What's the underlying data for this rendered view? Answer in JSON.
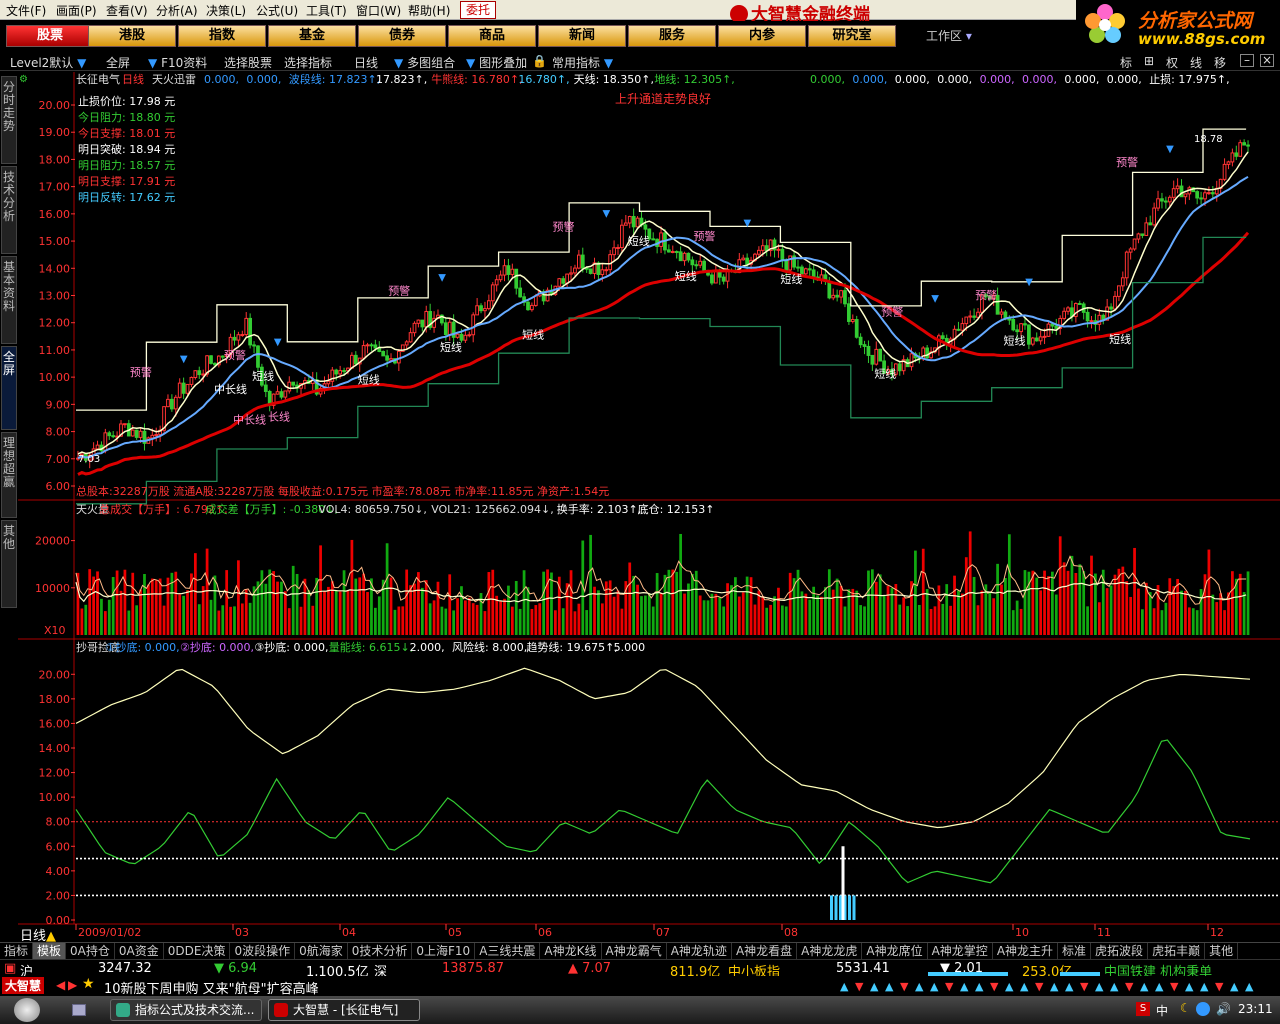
{
  "menu": [
    "文件(F)",
    "画面(P)",
    "查看(V)",
    "分析(A)",
    "决策(L)",
    "公式(U)",
    "工具(T)",
    "窗口(W)",
    "帮助(H)"
  ],
  "weituo": "委托",
  "brand": "大智慧金融终端",
  "site": {
    "name": "分析家公式网",
    "url": "www.88gs.com"
  },
  "nav": [
    "股票",
    "港股",
    "指数",
    "基金",
    "债券",
    "商品",
    "新闻",
    "服务",
    "内参",
    "研究室"
  ],
  "workspace": "工作区",
  "toolbar": {
    "level2": "Level2默认",
    "full": "全屏",
    "f10": "F10资料",
    "select": "选择股票",
    "pick": "选择指标",
    "period": "日线",
    "multi": "多图组合",
    "overlay": "图形叠加",
    "common": "常用指标",
    "right": [
      "标",
      "⊞",
      "权",
      "线",
      "移"
    ]
  },
  "sidetabs": [
    "分时走势",
    "技术分析",
    "基本资料",
    "全屏",
    "理想超赢",
    "其他"
  ],
  "price_panel": {
    "header_name": "长征电气",
    "header_period": "日线",
    "header_ind": "天火迅雷",
    "values": [
      {
        "t": "0.000,",
        "c": "#39f"
      },
      {
        "t": "0.000,",
        "c": "#39f"
      },
      {
        "t": "波段线: 17.823↑,",
        "c": "#39f"
      },
      {
        "t": "17.823↑,",
        "c": "#fff"
      },
      {
        "t": "牛熊线: 16.780↑,",
        "c": "#f33"
      },
      {
        "t": "16.780↑,",
        "c": "#4cf"
      },
      {
        "t": "天线: 18.350↑,",
        "c": "#fff"
      },
      {
        "t": "地线: 12.305↑,",
        "c": "#3c3"
      }
    ],
    "values2": [
      {
        "t": "0.000,",
        "c": "#3c3"
      },
      {
        "t": "0.000,",
        "c": "#39f"
      },
      {
        "t": "0.000,",
        "c": "#fff"
      },
      {
        "t": "0.000,",
        "c": "#fff"
      },
      {
        "t": "0.000,",
        "c": "#c6f"
      },
      {
        "t": "0.000,",
        "c": "#c6f"
      },
      {
        "t": "0.000,",
        "c": "#fff"
      },
      {
        "t": "0.000,",
        "c": "#fff"
      },
      {
        "t": "止损: 17.975↑,",
        "c": "#fff"
      }
    ],
    "trend": "上升通道走势良好",
    "levels": [
      {
        "l": "止损价位: 17.98 元",
        "c": "#fff"
      },
      {
        "l": "今日阻力: 18.80 元",
        "c": "#3c3"
      },
      {
        "l": "今日支撑: 18.01 元",
        "c": "#f33"
      },
      {
        "l": "明日突破: 18.94 元",
        "c": "#fff"
      },
      {
        "l": "明日阻力: 18.57 元",
        "c": "#3c3"
      },
      {
        "l": "明日支撑: 17.91 元",
        "c": "#f33"
      },
      {
        "l": "明日反转: 17.62 元",
        "c": "#4cf"
      }
    ],
    "yticks": [
      "20.00",
      "19.00",
      "18.00",
      "17.00",
      "16.00",
      "15.00",
      "14.00",
      "13.00",
      "12.00",
      "11.00",
      "10.00",
      "9.00",
      "8.00",
      "7.00",
      "6.00"
    ],
    "footer": "总股本:32287万股 流通A股:32287万股 每股收益:0.175元 市盈率:78.08元 市净率:11.85元 净资产:1.54元",
    "low_mark": "7.03",
    "high_mark": "18.78",
    "warn": "预警",
    "short": "短线",
    "midlong": "中长线",
    "long": "长线"
  },
  "vol_panel": {
    "header": [
      {
        "t": "天火量",
        "c": "#ddd"
      },
      {
        "t": "总成交【万手】: 6.792↑,",
        "c": "#f33"
      },
      {
        "t": "成交差【万手】: -0.380↓,",
        "c": "#3c3"
      },
      {
        "t": "VOL4: 80659.750↓,",
        "c": "#ddd"
      },
      {
        "t": "VOL21: 125662.094↓,",
        "c": "#ddd"
      },
      {
        "t": "换手率: 2.103↑,",
        "c": "#fff"
      },
      {
        "t": "底仓: 12.153↑",
        "c": "#fff"
      }
    ],
    "yticks": [
      "20000",
      "10000"
    ],
    "unit": "X10"
  },
  "osc_panel": {
    "header": [
      {
        "t": "抄哥捡底",
        "c": "#ddd"
      },
      {
        "t": "①抄底: 0.000,",
        "c": "#39f"
      },
      {
        "t": "②抄底: 0.000,",
        "c": "#c6f"
      },
      {
        "t": "③抄底: 0.000,",
        "c": "#fff"
      },
      {
        "t": "量能线: 6.615↓,",
        "c": "#3c3"
      },
      {
        "t": "2.000,",
        "c": "#fff"
      },
      {
        "t": "风险线: 8.000,",
        "c": "#fff"
      },
      {
        "t": "趋势线: 19.675↑,",
        "c": "#fff"
      },
      {
        "t": "5.000",
        "c": "#fff"
      }
    ],
    "yticks": [
      "20.00",
      "18.00",
      "16.00",
      "14.00",
      "12.00",
      "10.00",
      "8.00",
      "6.00",
      "4.00",
      "2.00",
      "0.00"
    ]
  },
  "date_axis": [
    "2009/01/02",
    "03",
    "04",
    "05",
    "06",
    "07",
    "08",
    "10",
    "11",
    "12"
  ],
  "period_label": "日线",
  "tabs": [
    "指标",
    "模板",
    "0A持仓",
    "0A资金",
    "0DDE决策",
    "0波段操作",
    "0航海家",
    "0技术分析",
    "0上海F10",
    "A三线共震",
    "A神龙K线",
    "A神龙霸气",
    "A神龙轨迹",
    "A神龙看盘",
    "A神龙龙虎",
    "A神龙席位",
    "A神龙掌控",
    "A神龙主升",
    "标准",
    "虎拓波段",
    "虎拓丰巅",
    "其他"
  ],
  "ticker": {
    "sh": "沪",
    "sh_idx": "3247.32",
    "sh_chg": "▼ 6.94",
    "sh_amt": "1,100.5亿",
    "sz": "深",
    "sz_idx": "13875.87",
    "sz_chg": "▲ 7.07",
    "sz_amt": "811.9亿",
    "mid": "中小板指",
    "mid_idx": "5531.41",
    "mid_chg": "▼ 2.01",
    "mid_amt": "253.0亿",
    "news": "中国铁建 机构秉单"
  },
  "newsline": {
    "logo": "大智慧",
    "text": "10新股下周申购 又来\"航母\"扩容高峰"
  },
  "taskbar": {
    "t1": "指标公式及技术交流...",
    "t2": "大智慧 - [长征电气]",
    "time": "23:11",
    "ime": "中"
  },
  "chart_data": [
    {
      "type": "candlestick",
      "title": "长征电气 日线",
      "ylim": [
        6,
        20.5
      ],
      "x_range": [
        "2009/01/02",
        "2009/12"
      ],
      "series": [
        {
          "name": "牛熊线",
          "last": 16.78
        },
        {
          "name": "波段线",
          "last": 17.823
        },
        {
          "name": "天线",
          "last": 18.35
        },
        {
          "name": "地线",
          "last": 12.305
        }
      ],
      "close_path": [
        7.03,
        7.6,
        8.2,
        7.7,
        9.2,
        10.2,
        10.8,
        12.0,
        9.0,
        10.0,
        9.5,
        10.3,
        11.0,
        10.5,
        11.8,
        12.3,
        11.2,
        12.8,
        14.0,
        12.6,
        13.5,
        14.3,
        14.0,
        15.8,
        15.2,
        14.8,
        14.0,
        13.5,
        14.2,
        14.7,
        14.0,
        13.6,
        12.8,
        11.0,
        10.3,
        10.6,
        11.2,
        12.0,
        13.0,
        12.2,
        11.4,
        12.0,
        12.5,
        12.0,
        14.5,
        16.0,
        17.0,
        16.5,
        17.5,
        18.78
      ]
    },
    {
      "type": "bar",
      "title": "天火量",
      "ylim": [
        0,
        25000
      ],
      "series": [
        {
          "name": "VOL4",
          "last": 80659.75
        },
        {
          "name": "VOL21",
          "last": 125662.094
        }
      ]
    },
    {
      "type": "line",
      "title": "抄哥捡底",
      "ylim": [
        0,
        21
      ],
      "series": [
        {
          "name": "趋势线",
          "last": 19.675,
          "path": [
            16,
            17.5,
            18.5,
            20.5,
            19,
            15.5,
            13.5,
            15,
            17.5,
            18.8,
            18.5,
            18.8,
            19.5,
            20.5,
            19.5,
            18,
            18.5,
            20.5,
            19,
            16,
            13,
            11,
            10.5,
            9,
            8,
            7.5,
            8,
            9.5,
            12,
            16,
            18,
            19.5,
            20,
            19.8,
            19.6
          ]
        },
        {
          "name": "量能线",
          "last": 6.615,
          "path": [
            9,
            5.5,
            4.5,
            6,
            9,
            5,
            7,
            11.5,
            8,
            6.5,
            9,
            5.5,
            7,
            10,
            8,
            6,
            5.5,
            8,
            7,
            9,
            8,
            7,
            11.5,
            9,
            8,
            7.5,
            4.5,
            8,
            6,
            3,
            4,
            3.5,
            3,
            6,
            9,
            8,
            7,
            10,
            15,
            12,
            7,
            6.6
          ]
        },
        {
          "name": "风险线",
          "value": 8
        },
        {
          "name": "",
          "value": 5
        },
        {
          "name": "",
          "value": 2
        }
      ]
    }
  ]
}
